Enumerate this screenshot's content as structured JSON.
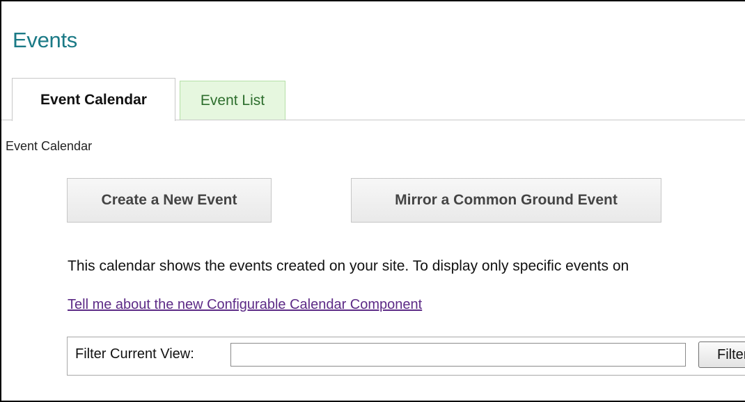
{
  "page": {
    "title": "Events"
  },
  "tabs": [
    {
      "label": "Event Calendar",
      "active": true
    },
    {
      "label": "Event List",
      "active": false
    }
  ],
  "breadcrumb": "Event Calendar",
  "actions": {
    "create_label": "Create a New Event",
    "mirror_label": "Mirror a Common Ground Event"
  },
  "description": "This calendar shows the events created on your site. To display only specific events on",
  "help_link": "Tell me about the new Configurable Calendar Component",
  "filter": {
    "label": "Filter Current View:",
    "value": "",
    "placeholder": "",
    "button_label": "Filter"
  },
  "colors": {
    "title": "#1b7a86",
    "inactive_tab_bg": "#e6f7df",
    "inactive_tab_text": "#2d6e2d",
    "link": "#5c2a86"
  }
}
